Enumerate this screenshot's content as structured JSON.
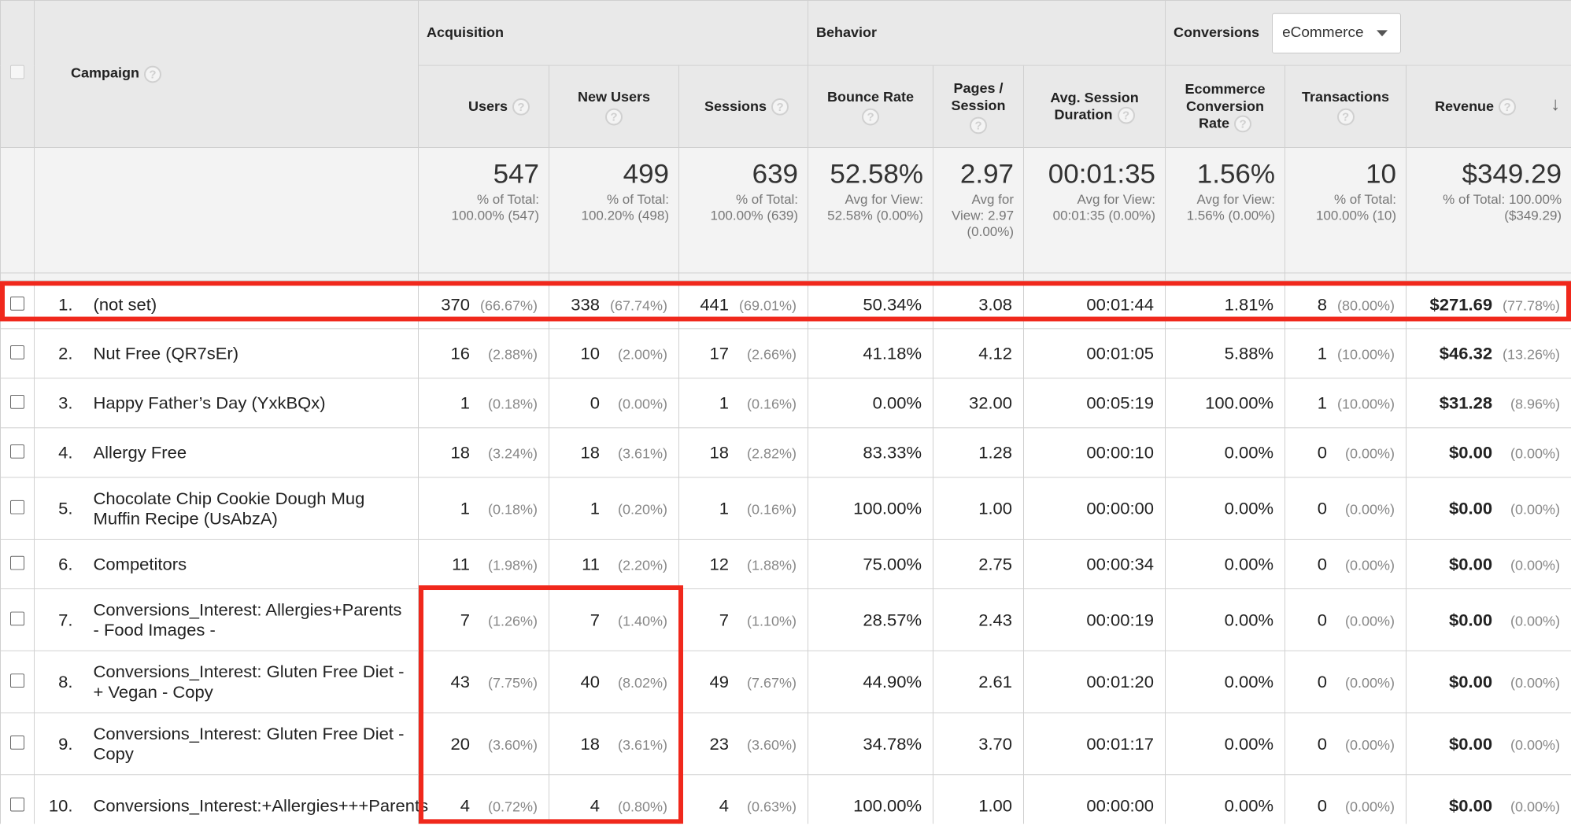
{
  "header": {
    "campaign_label": "Campaign",
    "groups": {
      "acquisition": "Acquisition",
      "behavior": "Behavior",
      "conversions": "Conversions"
    },
    "conversions_dropdown": {
      "selected": "eCommerce"
    },
    "metrics": [
      {
        "label": "Users"
      },
      {
        "label": "New Users"
      },
      {
        "label": "Sessions"
      },
      {
        "label": "Bounce Rate"
      },
      {
        "label": "Pages / Session"
      },
      {
        "label": "Avg. Session Duration"
      },
      {
        "label": "Ecommerce Conversion Rate"
      },
      {
        "label": "Transactions"
      },
      {
        "label": "Revenue"
      }
    ],
    "help_glyph": "?",
    "sort_arrow": "↓"
  },
  "totals": [
    {
      "value": "547",
      "sub": "% of Total: 100.00% (547)"
    },
    {
      "value": "499",
      "sub": "% of Total: 100.20% (498)"
    },
    {
      "value": "639",
      "sub": "% of Total: 100.00% (639)"
    },
    {
      "value": "52.58%",
      "sub": "Avg for View: 52.58% (0.00%)"
    },
    {
      "value": "2.97",
      "sub": "Avg for View: 2.97 (0.00%)"
    },
    {
      "value": "00:01:35",
      "sub": "Avg for View: 00:01:35 (0.00%)"
    },
    {
      "value": "1.56%",
      "sub": "Avg for View: 1.56% (0.00%)"
    },
    {
      "value": "10",
      "sub": "% of Total: 100.00% (10)"
    },
    {
      "value": "$349.29",
      "sub": "% of Total: 100.00% ($349.29)"
    }
  ],
  "rows": [
    {
      "index": "1.",
      "campaign": "(not set)",
      "users": "370",
      "users_pct": "(66.67%)",
      "new_users": "338",
      "new_users_pct": "(67.74%)",
      "sessions": "441",
      "sessions_pct": "(69.01%)",
      "bounce_rate": "50.34%",
      "pages_session": "3.08",
      "avg_duration": "00:01:44",
      "conv_rate": "1.81%",
      "transactions": "8",
      "transactions_pct": "(80.00%)",
      "revenue": "$271.69",
      "revenue_pct": "(77.78%)"
    },
    {
      "index": "2.",
      "campaign": "Nut Free (QR7sEr)",
      "users": "16",
      "users_pct": "(2.88%)",
      "new_users": "10",
      "new_users_pct": "(2.00%)",
      "sessions": "17",
      "sessions_pct": "(2.66%)",
      "bounce_rate": "41.18%",
      "pages_session": "4.12",
      "avg_duration": "00:01:05",
      "conv_rate": "5.88%",
      "transactions": "1",
      "transactions_pct": "(10.00%)",
      "revenue": "$46.32",
      "revenue_pct": "(13.26%)"
    },
    {
      "index": "3.",
      "campaign": "Happy Father’s Day (YxkBQx)",
      "users": "1",
      "users_pct": "(0.18%)",
      "new_users": "0",
      "new_users_pct": "(0.00%)",
      "sessions": "1",
      "sessions_pct": "(0.16%)",
      "bounce_rate": "0.00%",
      "pages_session": "32.00",
      "avg_duration": "00:05:19",
      "conv_rate": "100.00%",
      "transactions": "1",
      "transactions_pct": "(10.00%)",
      "revenue": "$31.28",
      "revenue_pct": "(8.96%)"
    },
    {
      "index": "4.",
      "campaign": "Allergy Free",
      "users": "18",
      "users_pct": "(3.24%)",
      "new_users": "18",
      "new_users_pct": "(3.61%)",
      "sessions": "18",
      "sessions_pct": "(2.82%)",
      "bounce_rate": "83.33%",
      "pages_session": "1.28",
      "avg_duration": "00:00:10",
      "conv_rate": "0.00%",
      "transactions": "0",
      "transactions_pct": "(0.00%)",
      "revenue": "$0.00",
      "revenue_pct": "(0.00%)"
    },
    {
      "index": "5.",
      "campaign": "Chocolate Chip Cookie Dough Mug Muffin Recipe (UsAbzA)",
      "users": "1",
      "users_pct": "(0.18%)",
      "new_users": "1",
      "new_users_pct": "(0.20%)",
      "sessions": "1",
      "sessions_pct": "(0.16%)",
      "bounce_rate": "100.00%",
      "pages_session": "1.00",
      "avg_duration": "00:00:00",
      "conv_rate": "0.00%",
      "transactions": "0",
      "transactions_pct": "(0.00%)",
      "revenue": "$0.00",
      "revenue_pct": "(0.00%)"
    },
    {
      "index": "6.",
      "campaign": "Competitors",
      "users": "11",
      "users_pct": "(1.98%)",
      "new_users": "11",
      "new_users_pct": "(2.20%)",
      "sessions": "12",
      "sessions_pct": "(1.88%)",
      "bounce_rate": "75.00%",
      "pages_session": "2.75",
      "avg_duration": "00:00:34",
      "conv_rate": "0.00%",
      "transactions": "0",
      "transactions_pct": "(0.00%)",
      "revenue": "$0.00",
      "revenue_pct": "(0.00%)"
    },
    {
      "index": "7.",
      "campaign": "Conversions_Interest: Allergies+Parents - Food Images -",
      "users": "7",
      "users_pct": "(1.26%)",
      "new_users": "7",
      "new_users_pct": "(1.40%)",
      "sessions": "7",
      "sessions_pct": "(1.10%)",
      "bounce_rate": "28.57%",
      "pages_session": "2.43",
      "avg_duration": "00:00:19",
      "conv_rate": "0.00%",
      "transactions": "0",
      "transactions_pct": "(0.00%)",
      "revenue": "$0.00",
      "revenue_pct": "(0.00%)"
    },
    {
      "index": "8.",
      "campaign": "Conversions_Interest: Gluten Free Diet - + Vegan - Copy",
      "users": "43",
      "users_pct": "(7.75%)",
      "new_users": "40",
      "new_users_pct": "(8.02%)",
      "sessions": "49",
      "sessions_pct": "(7.67%)",
      "bounce_rate": "44.90%",
      "pages_session": "2.61",
      "avg_duration": "00:01:20",
      "conv_rate": "0.00%",
      "transactions": "0",
      "transactions_pct": "(0.00%)",
      "revenue": "$0.00",
      "revenue_pct": "(0.00%)"
    },
    {
      "index": "9.",
      "campaign": "Conversions_Interest: Gluten Free Diet - Copy",
      "users": "20",
      "users_pct": "(3.60%)",
      "new_users": "18",
      "new_users_pct": "(3.61%)",
      "sessions": "23",
      "sessions_pct": "(3.60%)",
      "bounce_rate": "34.78%",
      "pages_session": "3.70",
      "avg_duration": "00:01:17",
      "conv_rate": "0.00%",
      "transactions": "0",
      "transactions_pct": "(0.00%)",
      "revenue": "$0.00",
      "revenue_pct": "(0.00%)"
    },
    {
      "index": "10.",
      "campaign": "Conversions_Interest:+Allergies+++Parents",
      "users": "4",
      "users_pct": "(0.72%)",
      "new_users": "4",
      "new_users_pct": "(0.80%)",
      "sessions": "4",
      "sessions_pct": "(0.63%)",
      "bounce_rate": "100.00%",
      "pages_session": "1.00",
      "avg_duration": "00:00:00",
      "conv_rate": "0.00%",
      "transactions": "0",
      "transactions_pct": "(0.00%)",
      "revenue": "$0.00",
      "revenue_pct": "(0.00%)"
    }
  ],
  "colors": {
    "highlight": "#f0281c",
    "header_bg": "#e9e9e9",
    "summary_bg": "#f3f3f3"
  }
}
